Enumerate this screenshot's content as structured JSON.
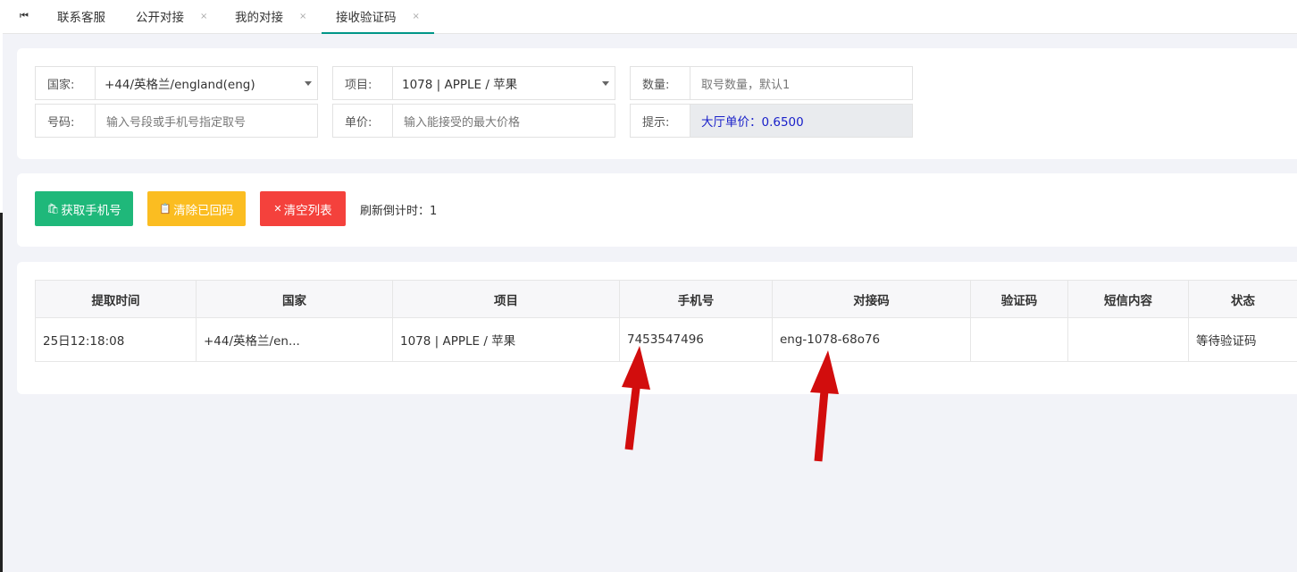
{
  "tabs": {
    "home_icon": "⏮",
    "items": [
      {
        "label": "联系客服",
        "closable": false
      },
      {
        "label": "公开对接",
        "closable": true
      },
      {
        "label": "我的对接",
        "closable": true
      },
      {
        "label": "接收验证码",
        "closable": true,
        "active": true
      }
    ],
    "close_glyph": "×"
  },
  "form": {
    "country_label": "国家:",
    "country_value": "+44/英格兰/england(eng)",
    "project_label": "项目:",
    "project_value": "1078 | APPLE / 苹果",
    "qty_label": "数量:",
    "qty_placeholder": "取号数量，默认1",
    "number_label": "号码:",
    "number_placeholder": "输入号段或手机号指定取号",
    "price_label": "单价:",
    "price_placeholder": "输入能接受的最大价格",
    "tip_label": "提示:",
    "tip_value": "大厅单价：0.6500"
  },
  "actions": {
    "get_phone_label": "获取手机号",
    "clear_received_label": "清除已回码",
    "clear_list_label": "清空列表",
    "countdown_text": "刷新倒计时：1",
    "icons": {
      "get_phone": "bag-icon",
      "clear_received": "clipboard-icon",
      "clear_list": "close-icon"
    }
  },
  "table": {
    "headers": [
      "提取时间",
      "国家",
      "项目",
      "手机号",
      "对接码",
      "验证码",
      "短信内容",
      "状态"
    ],
    "rows": [
      [
        "25日12:18:08",
        "+44/英格兰/en...",
        "1078 | APPLE / 苹果",
        "7453547496",
        "eng-1078-68o76",
        "",
        "",
        "等待验证码"
      ]
    ]
  },
  "colors": {
    "green": "#1fb87a",
    "yellow": "#fbbd21",
    "red": "#f4413c",
    "link": "#1e7bd8",
    "tip_text": "#1a21c9",
    "active_tab": "#009688",
    "arrow": "#d20d0d"
  }
}
